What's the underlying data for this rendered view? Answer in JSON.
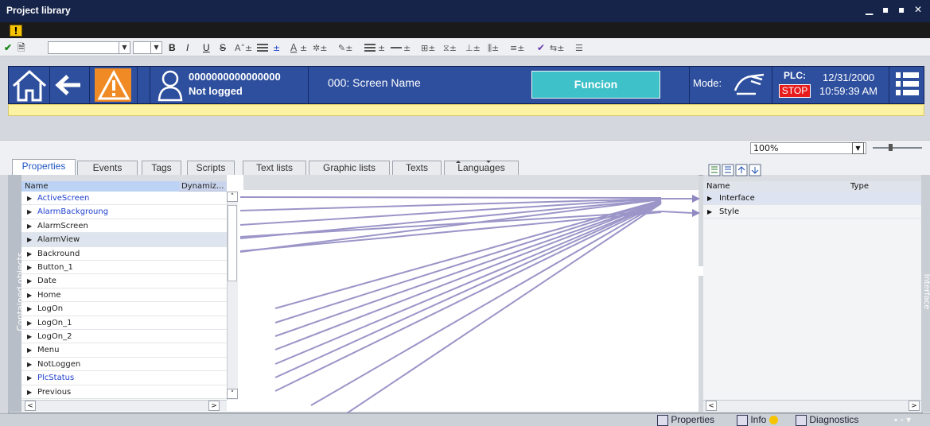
{
  "window": {
    "title": "Project library",
    "controls": "_ ▪ ▪ X"
  },
  "toolbar": {
    "icons": [
      "check-icon",
      "save-icon"
    ],
    "format": [
      "B",
      "I",
      "U",
      "S"
    ],
    "font_combo_value": "",
    "size_combo_value": ""
  },
  "hmi": {
    "user_id": "0000000000000000",
    "user_status": "Not logged",
    "screen_name": "000: Screen Name",
    "function_label": "Funcion",
    "mode_label": "Mode:",
    "plc_label": "PLC:",
    "stop_label": "STOP",
    "date": "12/31/2000",
    "time": "10:59:39 AM",
    "colors": {
      "header": "#2e4f9e",
      "accent": "#3ec1c8",
      "alarm": "#f08a24",
      "stop": "#e81c1c"
    }
  },
  "zoom": {
    "value": "100%"
  },
  "tabs": [
    {
      "label": "Properties",
      "active": true
    },
    {
      "label": "Events",
      "active": false
    },
    {
      "label": "Tags",
      "active": false
    },
    {
      "label": "Scripts",
      "active": false
    },
    {
      "label": "Text lists",
      "active": false
    },
    {
      "label": "Graphic lists",
      "active": false
    },
    {
      "label": "Texts",
      "active": false
    },
    {
      "label": "Languages",
      "active": false
    }
  ],
  "contained_objects": {
    "strip_label": "Contained objects",
    "columns": {
      "name": "Name",
      "dynamic": "Dynamiz..."
    },
    "items": [
      {
        "label": "ActiveScreen",
        "blue": true
      },
      {
        "label": "AlarmBackgroung",
        "blue": true
      },
      {
        "label": "AlarmScreen",
        "blue": false
      },
      {
        "label": "AlarmView",
        "blue": false,
        "selected": true
      },
      {
        "label": "Backround",
        "blue": false
      },
      {
        "label": "Button_1",
        "blue": false
      },
      {
        "label": "Date",
        "blue": false
      },
      {
        "label": "Home",
        "blue": false
      },
      {
        "label": "LogOn",
        "blue": false
      },
      {
        "label": "LogOn_1",
        "blue": false
      },
      {
        "label": "LogOn_2",
        "blue": false
      },
      {
        "label": "Menu",
        "blue": false
      },
      {
        "label": "NotLoggen",
        "blue": false
      },
      {
        "label": "PlcStatus",
        "blue": true
      },
      {
        "label": "Previous",
        "blue": false
      }
    ]
  },
  "interface": {
    "strip_label": "Interface",
    "columns": {
      "name": "Name",
      "type": "Type"
    },
    "items": [
      {
        "label": "Interface"
      },
      {
        "label": "Style"
      }
    ]
  },
  "statusbar": {
    "properties": "Properties",
    "info": "Info",
    "diagnostics": "Diagnostics"
  }
}
